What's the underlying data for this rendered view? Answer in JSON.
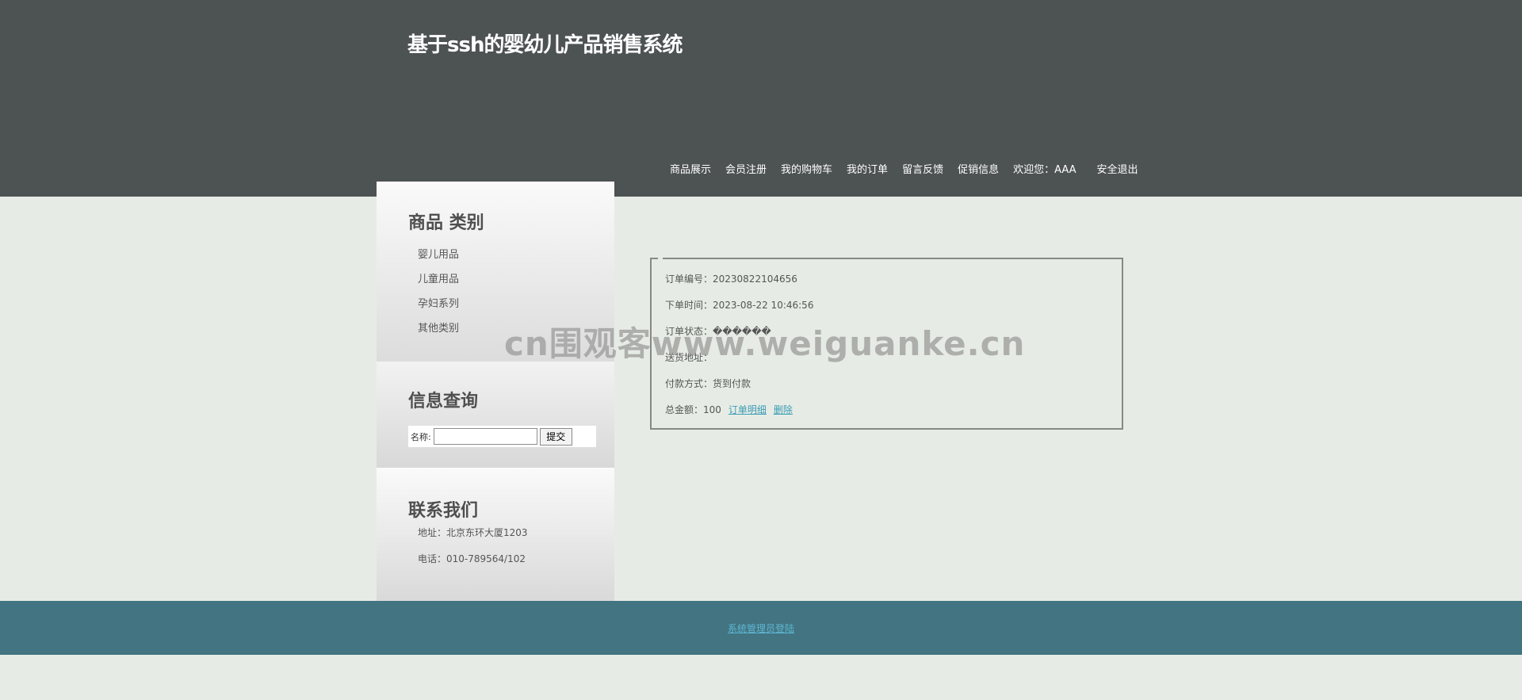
{
  "header": {
    "site_title": "基于ssh的婴幼儿产品销售系统",
    "nav": {
      "products": "商品展示",
      "register": "会员注册",
      "cart": "我的购物车",
      "orders": "我的订单",
      "feedback": "留言反馈",
      "promotions": "促销信息",
      "welcome": "欢迎您：AAA",
      "logout": "安全退出"
    }
  },
  "sidebar": {
    "categories": {
      "title": "商品 类别",
      "items": [
        "婴儿用品",
        "儿童用品",
        "孕妇系列",
        "其他类别"
      ]
    },
    "search": {
      "title": "信息查询",
      "label": "名称:",
      "input_value": "",
      "submit_label": "提交"
    },
    "contact": {
      "title": "联系我们",
      "address": "地址：北京东环大厦1203",
      "phone": "电话：010-789564/102"
    }
  },
  "order": {
    "number": "订单编号：20230822104656",
    "time": "下单时间：2023-08-22 10:46:56",
    "status": "订单状态：������",
    "address": "送货地址：",
    "payment": "付款方式：货到付款",
    "total": "总金额：100",
    "detail_link": "订单明细",
    "delete_link": "删除"
  },
  "watermark": "cn围观客www.weiguanke.cn",
  "footer": {
    "admin_link": "系统管理员登陆"
  }
}
